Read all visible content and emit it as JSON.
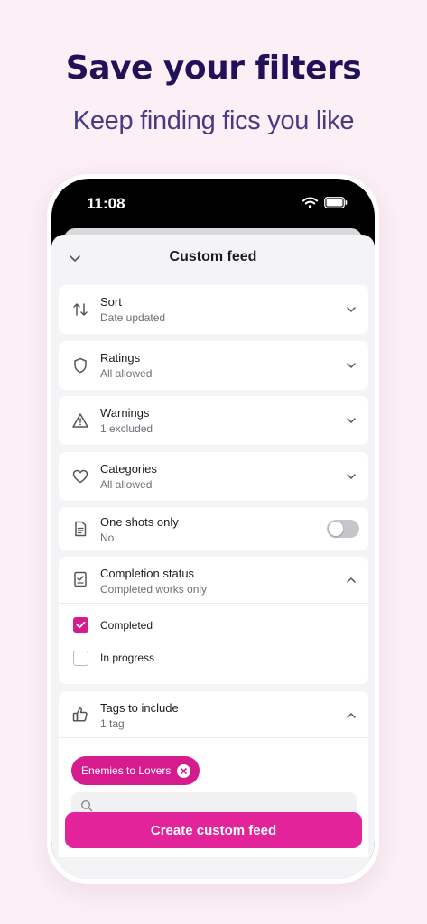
{
  "promo": {
    "headline": "Save your filters",
    "subheadline": "Keep finding fics you like"
  },
  "status_bar": {
    "time": "11:08",
    "icons": [
      "wifi-icon",
      "battery-icon"
    ]
  },
  "sheet": {
    "title": "Custom feed",
    "rows": [
      {
        "icon": "sort-arrows-icon",
        "title": "Sort",
        "subtitle": "Date updated",
        "control": "chevron-down"
      },
      {
        "icon": "shield-icon",
        "title": "Ratings",
        "subtitle": "All allowed",
        "control": "chevron-down"
      },
      {
        "icon": "warning-triangle-icon",
        "title": "Warnings",
        "subtitle": "1 excluded",
        "control": "chevron-down"
      },
      {
        "icon": "heart-icon",
        "title": "Categories",
        "subtitle": "All allowed",
        "control": "chevron-down"
      },
      {
        "icon": "document-icon",
        "title": "One shots only",
        "subtitle": "No",
        "control": "toggle",
        "toggle_on": false
      },
      {
        "icon": "checklist-icon",
        "title": "Completion status",
        "subtitle": "Completed works only",
        "control": "chevron-up"
      },
      {
        "icon": "thumbs-up-icon",
        "title": "Tags to include",
        "subtitle": "1 tag",
        "control": "chevron-up"
      }
    ],
    "completion_options": [
      {
        "label": "Completed",
        "checked": true
      },
      {
        "label": "In progress",
        "checked": false
      }
    ],
    "included_tags": [
      {
        "label": "Enemies to Lovers"
      }
    ],
    "cta_label": "Create custom feed"
  },
  "colors": {
    "background": "#fcf0f6",
    "headline": "#221058",
    "accent": "#e2239a"
  }
}
